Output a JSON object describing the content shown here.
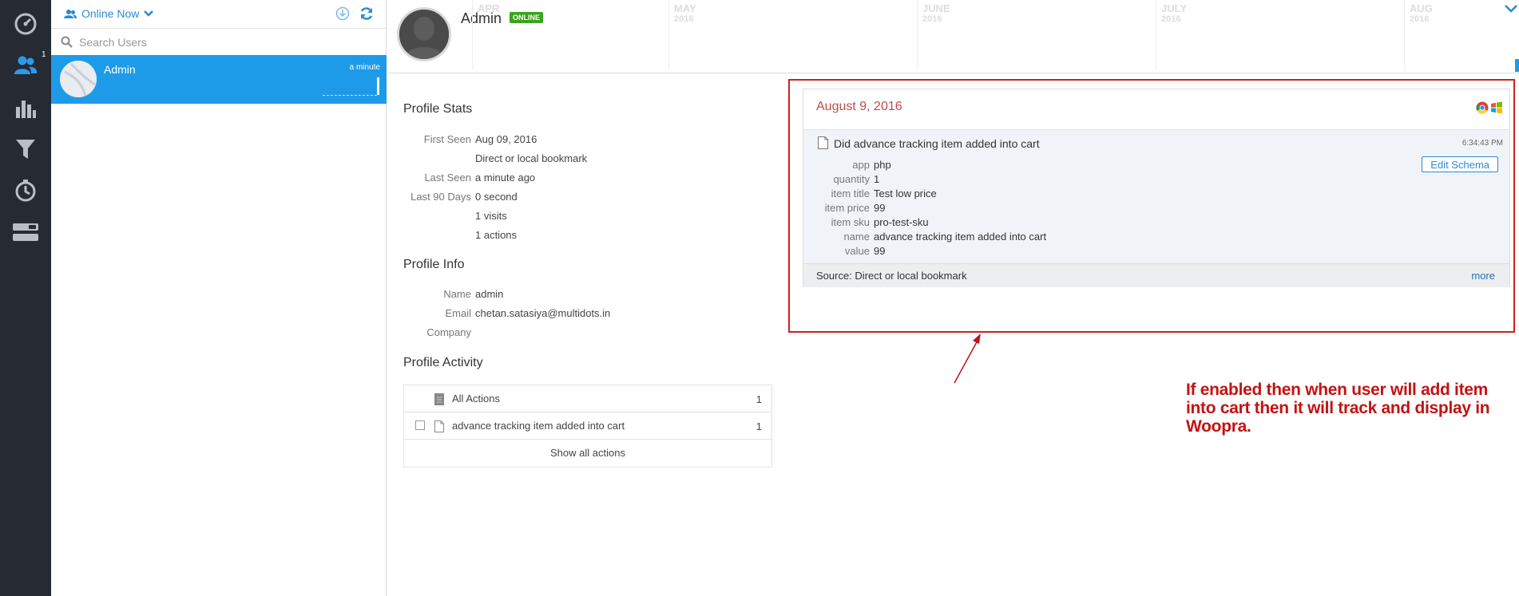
{
  "nav": {
    "items": [
      {
        "icon": "dashboard-gauge-icon"
      },
      {
        "icon": "users-icon",
        "badge": "1"
      },
      {
        "icon": "bar-chart-icon"
      },
      {
        "icon": "funnel-icon"
      },
      {
        "icon": "history-clock-icon"
      },
      {
        "icon": "toggles-icon"
      }
    ]
  },
  "userlist": {
    "filter_label": "Online Now",
    "search_placeholder": "Search Users",
    "users": [
      {
        "name": "Admin",
        "time": "a minute"
      }
    ]
  },
  "header": {
    "name": "Admin",
    "status": "ONLINE",
    "timeline": [
      {
        "month": "APR",
        "year": ""
      },
      {
        "month": "MAY",
        "year": "2016"
      },
      {
        "month": "JUNE",
        "year": "2016"
      },
      {
        "month": "JULY",
        "year": "2016"
      },
      {
        "month": "AUG",
        "year": "2016"
      }
    ]
  },
  "profile_stats": {
    "title": "Profile Stats",
    "rows": [
      {
        "key": "First Seen",
        "value": "Aug 09, 2016"
      },
      {
        "key": "",
        "value": "Direct or local bookmark"
      },
      {
        "key": "Last Seen",
        "value": "a minute ago"
      },
      {
        "key": "Last 90 Days",
        "value": "0 second"
      },
      {
        "key": "",
        "value": "1 visits"
      },
      {
        "key": "",
        "value": "1 actions"
      }
    ]
  },
  "profile_info": {
    "title": "Profile Info",
    "rows": [
      {
        "key": "Name",
        "value": "admin"
      },
      {
        "key": "Email",
        "value": "chetan.satasiya@multidots.in"
      },
      {
        "key": "Company",
        "value": ""
      }
    ]
  },
  "profile_activity": {
    "title": "Profile Activity",
    "all_label": "All Actions",
    "all_count": "1",
    "items": [
      {
        "label": "advance tracking item added into cart",
        "count": "1"
      }
    ],
    "show_all": "Show all actions"
  },
  "event": {
    "date": "August 9, 2016",
    "browsers": [
      "chrome-icon",
      "windows-icon"
    ],
    "title": "Did advance tracking item added into cart",
    "time": "6:34:43 PM",
    "edit_schema": "Edit Schema",
    "props": [
      {
        "key": "app",
        "value": "php"
      },
      {
        "key": "quantity",
        "value": "1"
      },
      {
        "key": "item title",
        "value": "Test low price"
      },
      {
        "key": "item price",
        "value": "99"
      },
      {
        "key": "item sku",
        "value": "pro-test-sku"
      },
      {
        "key": "name",
        "value": "advance tracking item added into cart"
      },
      {
        "key": "value",
        "value": "99"
      }
    ],
    "source": "Source: Direct or local bookmark",
    "more": "more"
  },
  "annotation": {
    "lines": [
      "If enabled then when user will add item",
      "into cart then it will track and display in",
      "Woopra."
    ],
    "color": "#c41212"
  },
  "colors": {
    "accent": "#1e9be8",
    "rail": "#252a33",
    "online": "#3aa41b",
    "date": "#c44a4a"
  }
}
